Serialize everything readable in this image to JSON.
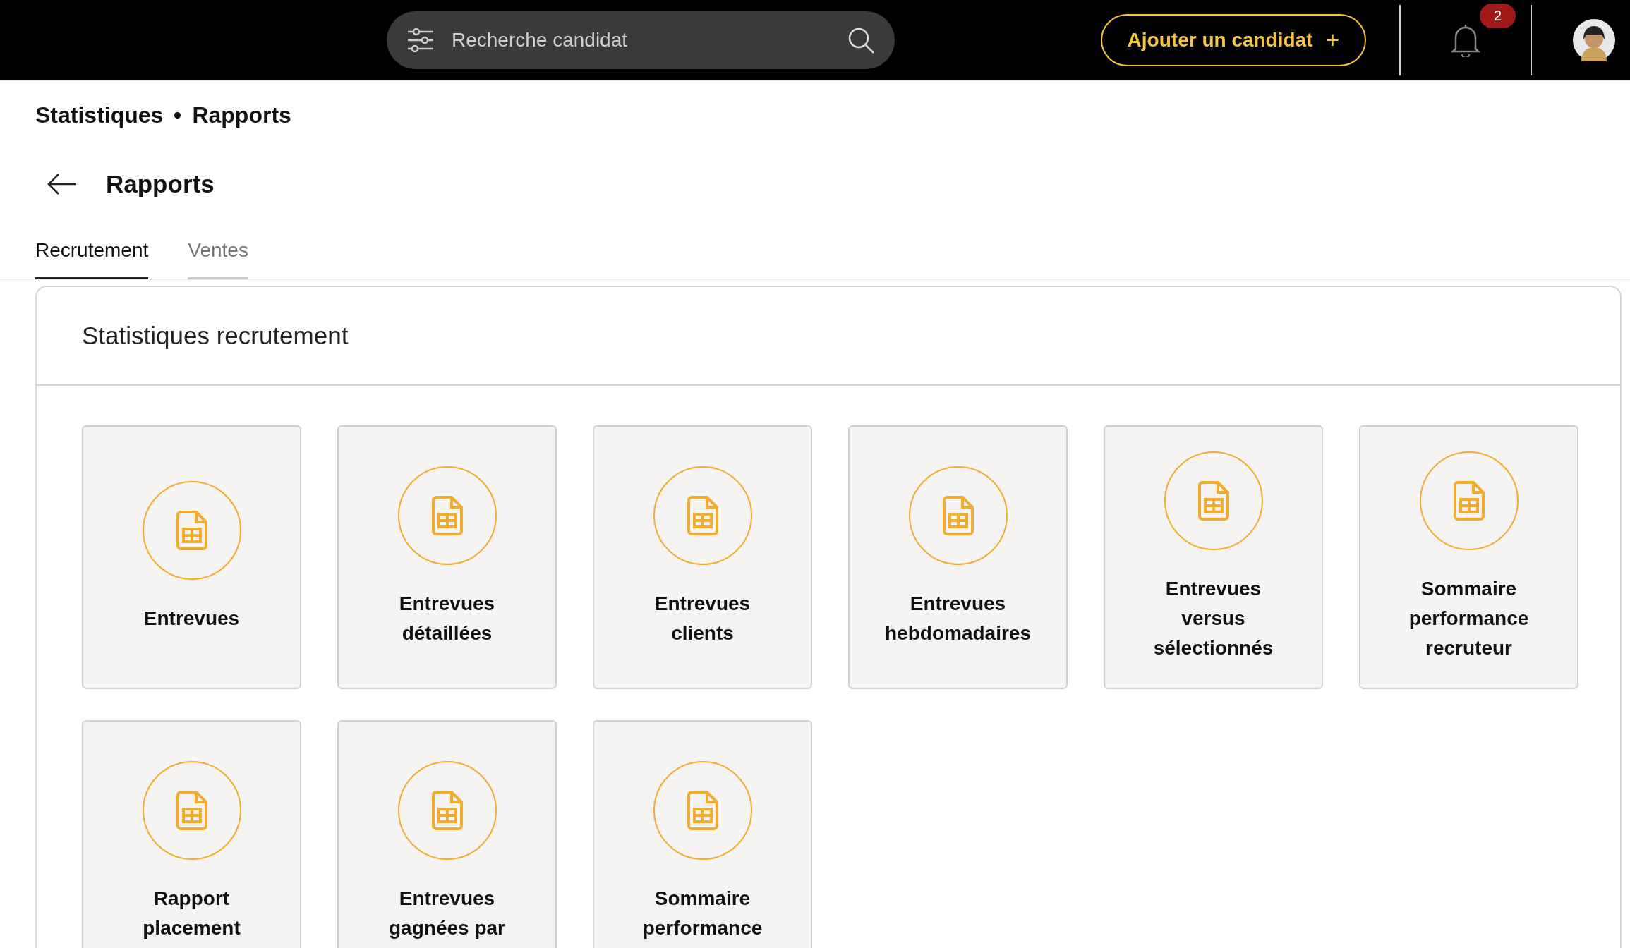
{
  "top_bar": {
    "search": {
      "placeholder": "Recherche candidat"
    },
    "add_button": "Ajouter un candidat",
    "add_icon": "+",
    "notifications": {
      "count": "2"
    }
  },
  "breadcrumb": [
    {
      "label": "Statistiques"
    },
    {
      "label": "Rapports"
    }
  ],
  "page_title": "Rapports",
  "tabs": [
    {
      "label": "Recrutement",
      "selected": true
    },
    {
      "label": "Ventes",
      "selected": false
    }
  ],
  "panel": {
    "title": "Statistiques recrutement",
    "reports": [
      {
        "label": "Entrevues"
      },
      {
        "label": "Entrevues\ndétaillées"
      },
      {
        "label": "Entrevues\nclients"
      },
      {
        "label": "Entrevues\nhebdomadaires"
      },
      {
        "label": "Entrevues\nversus\nsélectionnés"
      },
      {
        "label": "Sommaire\nperformance\nrecruteur"
      },
      {
        "label": "Rapport\nplacement"
      },
      {
        "label": "Entrevues\ngagnées par"
      },
      {
        "label": "Sommaire\nperformance"
      }
    ]
  }
}
